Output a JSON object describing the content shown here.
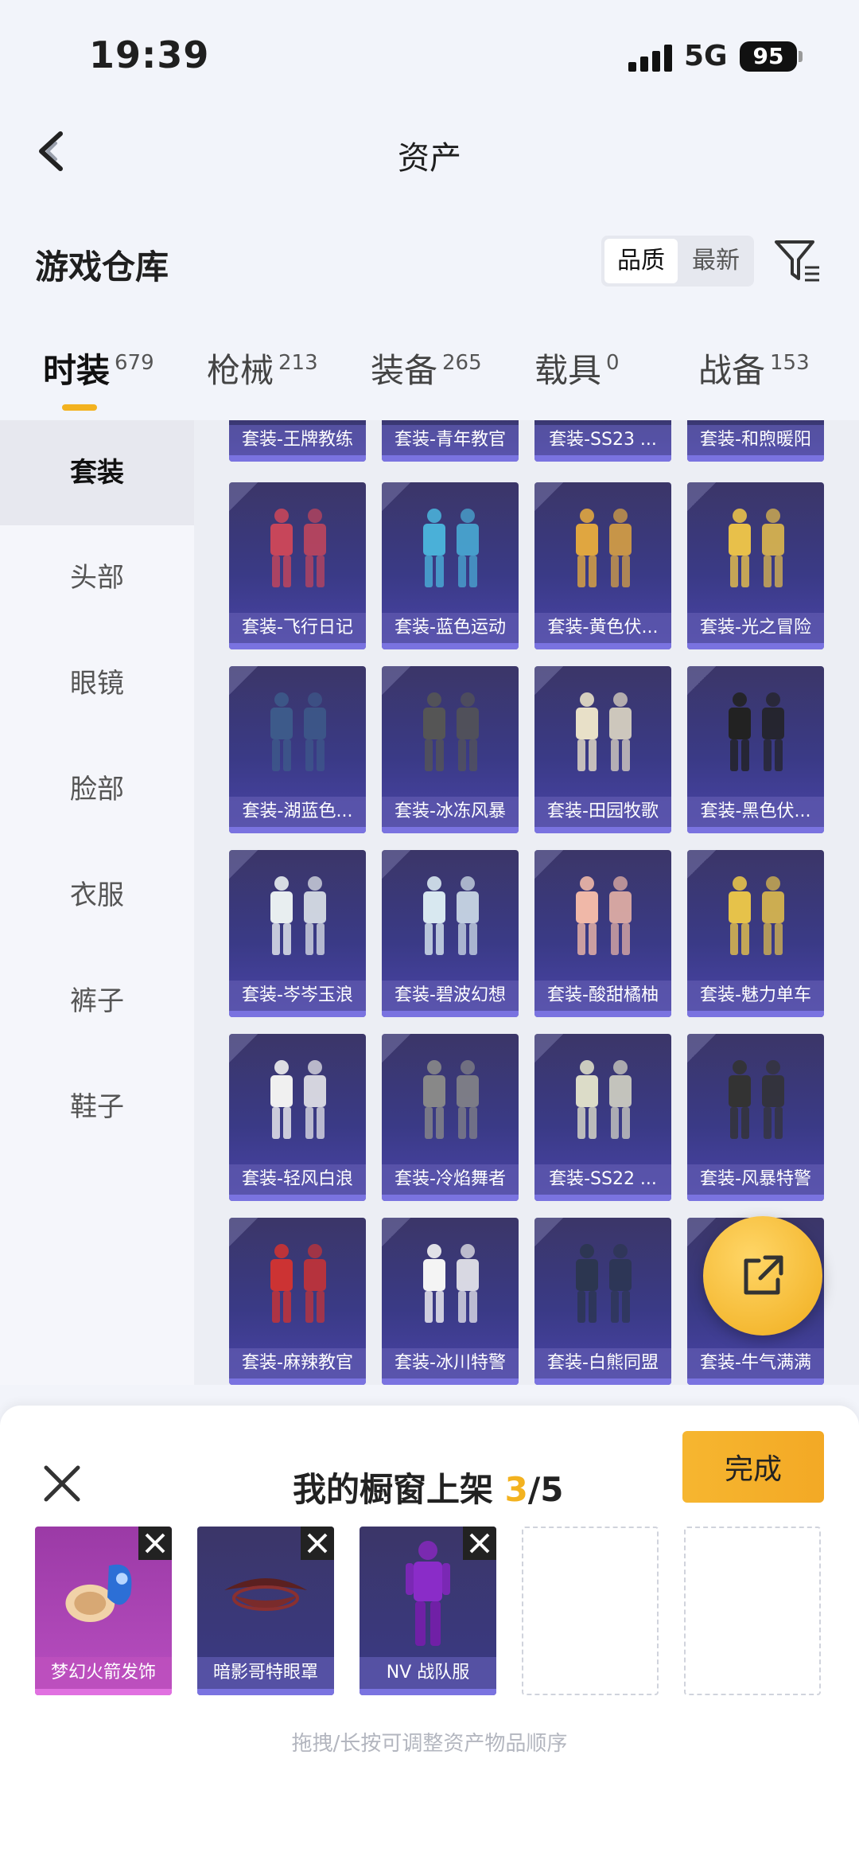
{
  "status_bar": {
    "time": "19:39",
    "network": "5G",
    "battery": "95"
  },
  "header": {
    "title": "资产"
  },
  "section": {
    "title": "游戏仓库",
    "sort_options": [
      "品质",
      "最新"
    ],
    "active_sort": "品质"
  },
  "tabs": [
    {
      "label": "时装",
      "count": "679"
    },
    {
      "label": "枪械",
      "count": "213"
    },
    {
      "label": "装备",
      "count": "265"
    },
    {
      "label": "载具",
      "count": "0"
    },
    {
      "label": "战备",
      "count": "153"
    }
  ],
  "active_tab": "时装",
  "sidebar": {
    "items": [
      "套装",
      "头部",
      "眼镜",
      "脸部",
      "衣服",
      "裤子",
      "鞋子"
    ],
    "active": "套装"
  },
  "grid": {
    "partial_row": [
      "套装-王牌教练",
      "套装-青年教官",
      "套装-SS23 ...",
      "套装-和煦暖阳"
    ],
    "rows": [
      [
        "套装-飞行日记",
        "套装-蓝色运动",
        "套装-黄色伏...",
        "套装-光之冒险"
      ],
      [
        "套装-湖蓝色...",
        "套装-冰冻风暴",
        "套装-田园牧歌",
        "套装-黑色伏..."
      ],
      [
        "套装-岑岑玉浪",
        "套装-碧波幻想",
        "套装-酸甜橘柚",
        "套装-魅力单车"
      ],
      [
        "套装-轻风白浪",
        "套装-冷焰舞者",
        "套装-SS22 ...",
        "套装-风暴特警"
      ],
      [
        "套装-麻辣教官",
        "套装-冰川特警",
        "套装-白熊同盟",
        "套装-牛气满满"
      ]
    ]
  },
  "share_button": {
    "icon": "share-icon"
  },
  "sheet": {
    "title_prefix": "我的橱窗上架 ",
    "current": "3",
    "total": "/5",
    "done_label": "完成",
    "slots": [
      {
        "label": "梦幻火箭发饰",
        "rarity_color": "#c14fc2"
      },
      {
        "label": "暗影哥特眼罩",
        "rarity_color": "#5a54b8"
      },
      {
        "label": "NV 战队服",
        "rarity_color": "#5a54b8"
      }
    ],
    "empty_slots": 2,
    "hint": "拖拽/长按可调整资产物品顺序"
  },
  "colors": {
    "accent": "#f3b21f",
    "card_purple": "#3a3a86",
    "epic_pink": "#c14fc2"
  }
}
